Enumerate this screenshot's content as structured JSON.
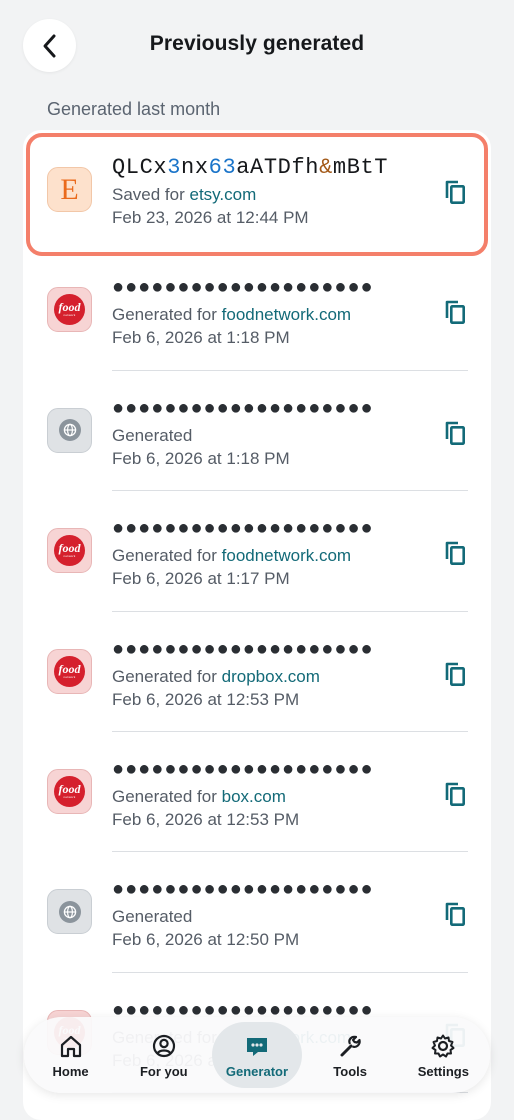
{
  "header": {
    "title": "Previously generated",
    "back_label": "Back"
  },
  "section": {
    "title": "Generated last month"
  },
  "entries": [
    {
      "icon": "etsy-logo",
      "icon_letter": "E",
      "revealed": true,
      "password_parts": [
        {
          "text": "QLCx",
          "kind": "letter"
        },
        {
          "text": "3",
          "kind": "digit"
        },
        {
          "text": "nx",
          "kind": "letter"
        },
        {
          "text": "63",
          "kind": "digit"
        },
        {
          "text": "aATDfh",
          "kind": "letter"
        },
        {
          "text": "&",
          "kind": "symbol"
        },
        {
          "text": "mBtT",
          "kind": "letter"
        }
      ],
      "status": "Saved for",
      "domain": "etsy.com",
      "date": "Feb 23, 2026 at 12:44 PM"
    },
    {
      "icon": "food-network-logo",
      "masked": "●●●●●●●●●●●●●●●●●●●●",
      "status": "Generated for",
      "domain": "foodnetwork.com",
      "date": "Feb 6, 2026 at 1:18 PM"
    },
    {
      "icon": "globe-icon",
      "masked": "●●●●●●●●●●●●●●●●●●●●",
      "status": "Generated",
      "domain": "",
      "date": "Feb 6, 2026 at 1:18 PM"
    },
    {
      "icon": "food-network-logo",
      "masked": "●●●●●●●●●●●●●●●●●●●●",
      "status": "Generated for",
      "domain": "foodnetwork.com",
      "date": "Feb 6, 2026 at 1:17 PM"
    },
    {
      "icon": "food-network-logo",
      "masked": "●●●●●●●●●●●●●●●●●●●●",
      "status": "Generated for",
      "domain": "dropbox.com",
      "date": "Feb 6, 2026 at 12:53 PM"
    },
    {
      "icon": "food-network-logo",
      "masked": "●●●●●●●●●●●●●●●●●●●●",
      "status": "Generated for",
      "domain": "box.com",
      "date": "Feb 6, 2026 at 12:53 PM"
    },
    {
      "icon": "globe-icon",
      "masked": "●●●●●●●●●●●●●●●●●●●●",
      "status": "Generated",
      "domain": "",
      "date": "Feb 6, 2026 at 12:50 PM"
    },
    {
      "icon": "food-network-logo",
      "masked": "●●●●●●●●●●●●●●●●●●●●",
      "status": "Generated for",
      "domain": "foodnetwork.com",
      "date": "Feb 6, 2026 at 12:50 PM"
    }
  ],
  "food_logo_text": {
    "word": "food",
    "sub": "network"
  },
  "nav": {
    "items": [
      {
        "label": "Home",
        "icon": "home-icon",
        "active": false
      },
      {
        "label": "For you",
        "icon": "user-circle-icon",
        "active": false
      },
      {
        "label": "Generator",
        "icon": "generator-icon",
        "active": true
      },
      {
        "label": "Tools",
        "icon": "wrench-icon",
        "active": false
      },
      {
        "label": "Settings",
        "icon": "gear-icon",
        "active": false
      }
    ]
  },
  "colors": {
    "accent": "#136a78",
    "highlight_ring": "#f47f6a",
    "digit": "#1a74c9",
    "symbol": "#a35a1a"
  }
}
